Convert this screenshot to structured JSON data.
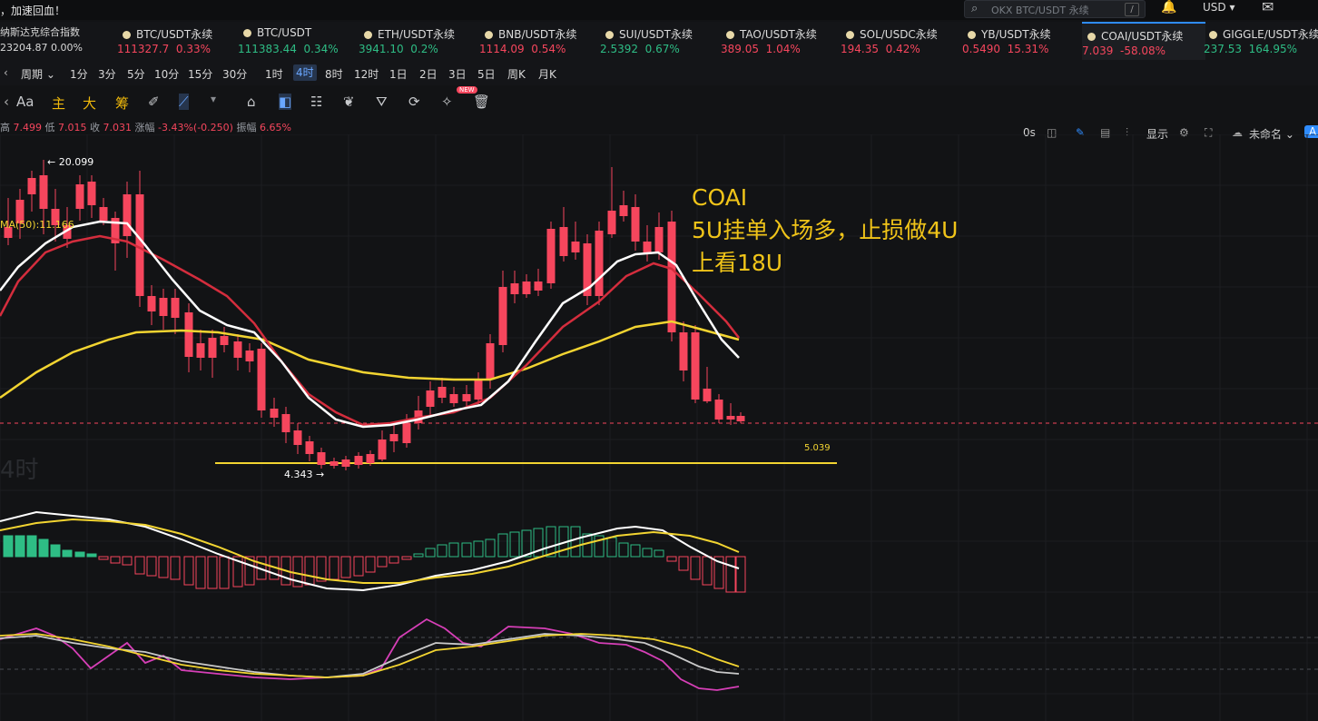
{
  "header": {
    "notice": "，加速回血！",
    "search_placeholder": "OKX BTC/USDT 永续",
    "search_shortcut": "/",
    "currency": "USD ▾",
    "bell_icon": "bell-icon",
    "mail_icon": "mail-icon"
  },
  "index": {
    "name": "纳斯达克综合指数",
    "value": "23204.87  0.00%"
  },
  "tickers": [
    {
      "name": "BTC/USDT永续",
      "price": "111327.7",
      "change": "0.33%",
      "dir": "dn"
    },
    {
      "name": "BTC/USDT",
      "price": "111383.44",
      "change": "0.34%",
      "dir": "up"
    },
    {
      "name": "ETH/USDT永续",
      "price": "3941.10",
      "change": "0.2%",
      "dir": "up"
    },
    {
      "name": "BNB/USDT永续",
      "price": "1114.09",
      "change": "0.54%",
      "dir": "dn"
    },
    {
      "name": "SUI/USDT永续",
      "price": "2.5392",
      "change": "0.67%",
      "dir": "up"
    },
    {
      "name": "TAO/USDT永续",
      "price": "389.05",
      "change": "1.04%",
      "dir": "dn"
    },
    {
      "name": "SOL/USDC永续",
      "price": "194.35",
      "change": "0.42%",
      "dir": "dn"
    },
    {
      "name": "YB/USDT永续",
      "price": "0.5490",
      "change": "15.31%",
      "dir": "dn"
    },
    {
      "name": "COAI/USDT永续",
      "price": "7.039",
      "change": "-58.08%",
      "dir": "dn"
    },
    {
      "name": "GIGGLE/USDT永续",
      "price": "237.53",
      "change": "164.95%",
      "dir": "up"
    }
  ],
  "toolbar": {
    "period": "周期 ⌄",
    "timeframes": [
      "1分",
      "3分",
      "5分",
      "10分",
      "15分",
      "30分",
      "1时",
      "4时",
      "8时",
      "12时",
      "1日",
      "2日",
      "3日",
      "5日",
      "周K",
      "月K"
    ],
    "selected": "4时",
    "countdown": "0s",
    "display": "显示",
    "layout_name": "未命名 ⌄"
  },
  "draw_tools": {
    "font": "Aa",
    "main": "主",
    "big": "大",
    "chips": "筹",
    "new_badge": "NEW"
  },
  "ohlc": {
    "high_label": "高",
    "high": "7.499",
    "low_label": "低",
    "low": "7.015",
    "close_label": "收",
    "close": "7.031",
    "change_label": "涨幅",
    "change": "-3.43%(-0.250)",
    "amp_label": "振幅",
    "amp": "6.65%"
  },
  "chart_labels": {
    "ma_label": "MA(50):11.166",
    "high_mark": "← 20.099",
    "low_mark": "4.343 →",
    "line_value": "5.039",
    "watermark": "4时"
  },
  "annotation": {
    "line1": "COAI",
    "line2": "5U挂单入场多，止损做4U",
    "line3": "上看18U"
  },
  "colors": {
    "up": "#2ebd85",
    "down": "#f6465d",
    "accent": "#2f8cff",
    "anno": "#f0c419",
    "ma50": "#f2d431"
  }
}
